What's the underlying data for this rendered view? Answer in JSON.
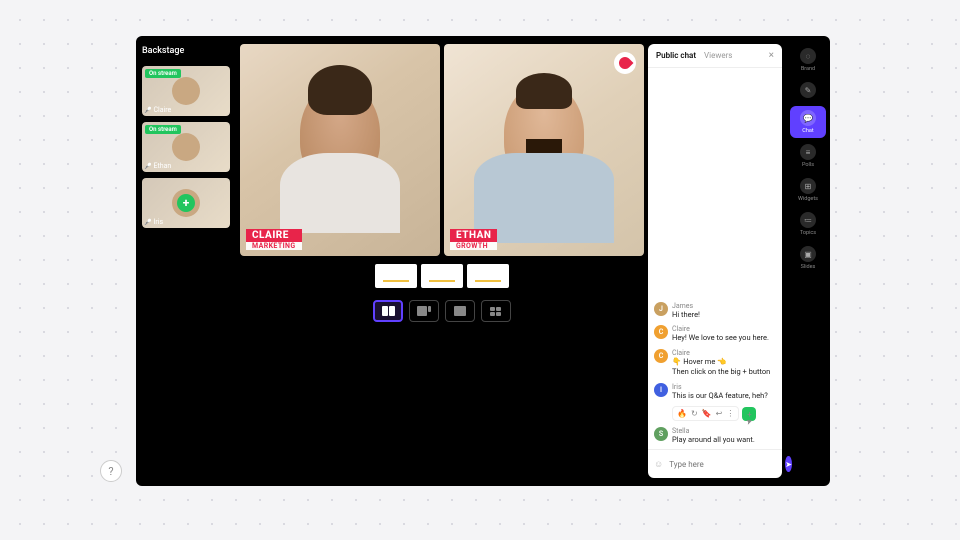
{
  "backstage": {
    "title": "Backstage",
    "on_stream_badge": "On stream",
    "thumbs": [
      {
        "name": "Claire",
        "on": true
      },
      {
        "name": "Ethan",
        "on": true
      },
      {
        "name": "Iris",
        "on": false,
        "add": true
      }
    ]
  },
  "stage": {
    "tiles": [
      {
        "name": "CLAIRE",
        "role": "MARKETING"
      },
      {
        "name": "ETHAN",
        "role": "GROWTH"
      }
    ]
  },
  "chat": {
    "tabs": {
      "public": "Public chat",
      "viewers": "Viewers"
    },
    "close": "×",
    "input_placeholder": "Type here",
    "messages": [
      {
        "av": "J",
        "color": "#c9a060",
        "name": "James",
        "text": "Hi there!"
      },
      {
        "av": "C",
        "color": "#f0a030",
        "name": "Claire",
        "text": "Hey! We love to see you here."
      },
      {
        "av": "C",
        "color": "#f0a030",
        "name": "Claire",
        "text": "👇 Hover me 👈\nThen click on the big + button"
      },
      {
        "av": "I",
        "color": "#4060e0",
        "name": "Iris",
        "text": "This is our Q&A feature, heh?",
        "actions": true
      },
      {
        "av": "S",
        "color": "#60a060",
        "name": "Stella",
        "text": "Play around all you want."
      }
    ],
    "actions_icons": [
      "🔥",
      "↻",
      "🔖",
      "↩",
      "⋮"
    ]
  },
  "rail": {
    "items": [
      {
        "icon": "◌",
        "label": "Brand"
      },
      {
        "icon": "✎",
        "label": ""
      },
      {
        "icon": "💬",
        "label": "Chat",
        "active": true
      },
      {
        "icon": "≡",
        "label": "Polls"
      },
      {
        "icon": "⊞",
        "label": "Widgets"
      },
      {
        "icon": "≔",
        "label": "Topics"
      },
      {
        "icon": "▣",
        "label": "Slides"
      }
    ]
  },
  "help": "?"
}
